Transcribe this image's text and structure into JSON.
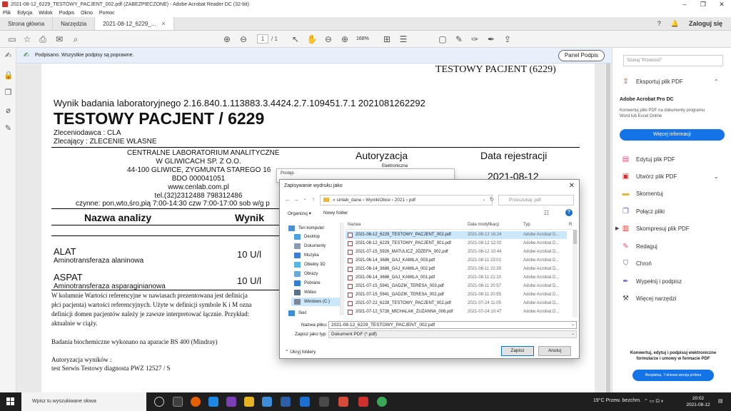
{
  "window": {
    "title": "2021-08-12_6229_TESTOWY_PACJENT_002.pdf (ZABEZPIECZONE) - Adobe Acrobat Reader DC (32-bit)"
  },
  "menu": [
    "Plik",
    "Edycja",
    "Widok",
    "Podpis",
    "Okno",
    "Pomoc"
  ],
  "tabs": {
    "home": "Strona główna",
    "tools": "Narzędzia",
    "doc": "2021-08-12_6229_...",
    "login": "Zaloguj się"
  },
  "toolbar": {
    "page_current": "1",
    "page_total": "/ 1",
    "zoom": "168%"
  },
  "signature_bar": {
    "message": "Podpisano. Wszystkie podpisy są poprawne.",
    "panel_button": "Panel Podpis"
  },
  "document": {
    "header_right": "TESTOWY PACJENT (6229)",
    "result_line": "Wynik badania laboratoryjnego 2.16.840.1.113883.3.4424.2.7.109451.7.1 2021081262292",
    "patient_name": "TESTOWY PACJENT / 6229",
    "orderer": "Zleceniodawca : CLA",
    "requester": "Zlecający : ZLECENIE WŁASNE",
    "lab": [
      "CENTRALNE LABORATORIUM ANALITYCZNE",
      "W GLIWICACH SP. Z O.O.",
      "44-100 GLIWICE, ZYGMUNTA STAREGO 16",
      "BDO 000041051",
      "www.cenlab.com.pl",
      "tel.(32)2312488 798312486",
      "czynne: pon,wto,śro,pią 7:00-14:30 czw 7:00-17:00 sob w/g p"
    ],
    "authorization_header": "Autoryzacja",
    "registration_header": "Data rejestracji",
    "registration_date": "2021-08-12",
    "electronic_partial": "Elektroniczna",
    "table_header_name": "Nazwa analizy",
    "table_header_result": "Wynik",
    "rows": [
      {
        "code": "ALAT",
        "name": "Aminotransferaza alaninowa",
        "value": "10 U/l"
      },
      {
        "code": "ASPAT",
        "name": "Aminotransferaza asparaginianowa",
        "value": "10 U/l"
      }
    ],
    "note_lines": [
      "W kolumnie Wartości referencyjne w nawiasach prezentowana jest definicja",
      "płci pacjenta) wartości referencyjnych. Użyte w definicji symbole K i M ozna",
      "definicji domen pacjentów należy je zawsze interpretować łącznie. Przykład:",
      "aktualnie w ciąży."
    ],
    "analyzer": "Badania biochemiczne wykonano na aparacie BS 400 (Mindray)",
    "authorization_label": "Autoryzacja wyników :",
    "authorized_by": "test Serwis Testowy diagnosta PWZ 12527 / S"
  },
  "right_panel": {
    "search_placeholder": "Szukaj \"Przekreśl\"",
    "export": "Eksportuj plik PDF",
    "promo_title": "Adobe Acrobat Pro DC",
    "promo_text": "Konwertuj pliki PDF na dokumenty programu Word lub Excel Online",
    "promo_button": "Więcej informacji",
    "tools": [
      "Edytuj plik PDF",
      "Utwórz plik PDF",
      "Skomentuj",
      "Połącz pliki",
      "Skompresuj plik PDF",
      "Redaguj",
      "Chroń",
      "Wypełnij i podpisz",
      "Więcej narzędzi"
    ],
    "footer_text": "Konwertuj, edytuj i podpisuj elektroniczne formularze i umowy w formacie PDF",
    "footer_button": "Bezpłatna, 7-dniowa wersja próbna"
  },
  "ghost_window": {
    "title": "Postęp"
  },
  "save_dialog": {
    "title": "Zapisywanie wydruku jako",
    "breadcrumb": "«  sinlab_dane  ›  WynikiObce  ›  2021  ›  pdf",
    "search_placeholder": "Przeszukaj: pdf",
    "organize": "Organizuj ▾",
    "new_folder": "Nowy folder",
    "tree": [
      "Ten komputer",
      "Desktop",
      "Dokumenty",
      "Muzyka",
      "Obiekty 3D",
      "Obrazy",
      "Pobrane",
      "Wideo",
      "Windows (C:)",
      "Sieć"
    ],
    "col_name": "Nazwa",
    "col_date": "Data modyfikacji",
    "col_type": "Typ",
    "col_more": "R",
    "files": [
      {
        "name": "2021-08-12_6229_TESTOWY_PACJENT_002.pdf",
        "date": "2021-08-12 16:24",
        "type": "Adobe Acrobat D..."
      },
      {
        "name": "2021-08-12_6229_TESTOWY_PACJENT_001.pdf",
        "date": "2021-08-12 12:02",
        "type": "Adobe Acrobat D..."
      },
      {
        "name": "2021-07-15_5926_MATULICZ_JÓZEFA_002.pdf",
        "date": "2021-08-12 10:44",
        "type": "Adobe Acrobat D..."
      },
      {
        "name": "2021-06-14_3686_GAJ_KAMILA_003.pdf",
        "date": "2021-08-11 23:01",
        "type": "Adobe Acrobat D..."
      },
      {
        "name": "2021-06-14_3686_GAJ_KAMILA_002.pdf",
        "date": "2021-08-11 22:35",
        "type": "Adobe Acrobat D..."
      },
      {
        "name": "2021-06-14_3686_GAJ_KAMILA_001.pdf",
        "date": "2021-08-11 21:10",
        "type": "Adobe Acrobat D..."
      },
      {
        "name": "2021-07-15_5941_GADZIK_TERESA_003.pdf",
        "date": "2021-08-11 20:57",
        "type": "Adobe Acrobat D..."
      },
      {
        "name": "2021-07-15_5941_GADZIK_TERESA_002.pdf",
        "date": "2021-08-11 20:55",
        "type": "Adobe Acrobat D..."
      },
      {
        "name": "2021-07-22_6228_TESTOWY_PACJENT_002.pdf",
        "date": "2021-07-24 11:05",
        "type": "Adobe Acrobat D..."
      },
      {
        "name": "2021-07-12_5726_MICHALAK_ZUZANNA_006.pdf",
        "date": "2021-07-24 10:47",
        "type": "Adobe Acrobat D..."
      }
    ],
    "filename_label": "Nazwa pliku:",
    "filename_value": "2021-08-12_6229_TESTOWY_PACJENT_002.pdf",
    "filetype_label": "Zapisz jako typ:",
    "filetype_value": "Dokument PDF (*.pdf)",
    "hide_folders": "Ukryj foldery",
    "save": "Zapisz",
    "cancel": "Anuluj"
  },
  "taskbar": {
    "search_placeholder": "Wpisz tu wyszukiwane słowa",
    "weather": "19°C  Przew. bezchm.",
    "time": "20:02",
    "date": "2021-08-12"
  },
  "colors": {
    "accent": "#1473e6",
    "sig_bar": "#e6effa",
    "pdf_red": "#d1312c"
  }
}
